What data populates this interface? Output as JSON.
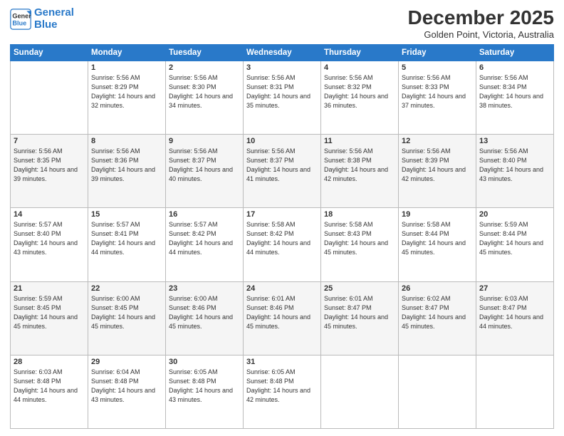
{
  "logo": {
    "line1": "General",
    "line2": "Blue"
  },
  "title": "December 2025",
  "subtitle": "Golden Point, Victoria, Australia",
  "days_header": [
    "Sunday",
    "Monday",
    "Tuesday",
    "Wednesday",
    "Thursday",
    "Friday",
    "Saturday"
  ],
  "weeks": [
    [
      {
        "day": "",
        "sunrise": "",
        "sunset": "",
        "daylight": ""
      },
      {
        "day": "1",
        "sunrise": "5:56 AM",
        "sunset": "8:29 PM",
        "daylight": "14 hours and 32 minutes."
      },
      {
        "day": "2",
        "sunrise": "5:56 AM",
        "sunset": "8:30 PM",
        "daylight": "14 hours and 34 minutes."
      },
      {
        "day": "3",
        "sunrise": "5:56 AM",
        "sunset": "8:31 PM",
        "daylight": "14 hours and 35 minutes."
      },
      {
        "day": "4",
        "sunrise": "5:56 AM",
        "sunset": "8:32 PM",
        "daylight": "14 hours and 36 minutes."
      },
      {
        "day": "5",
        "sunrise": "5:56 AM",
        "sunset": "8:33 PM",
        "daylight": "14 hours and 37 minutes."
      },
      {
        "day": "6",
        "sunrise": "5:56 AM",
        "sunset": "8:34 PM",
        "daylight": "14 hours and 38 minutes."
      }
    ],
    [
      {
        "day": "7",
        "sunrise": "5:56 AM",
        "sunset": "8:35 PM",
        "daylight": "14 hours and 39 minutes."
      },
      {
        "day": "8",
        "sunrise": "5:56 AM",
        "sunset": "8:36 PM",
        "daylight": "14 hours and 39 minutes."
      },
      {
        "day": "9",
        "sunrise": "5:56 AM",
        "sunset": "8:37 PM",
        "daylight": "14 hours and 40 minutes."
      },
      {
        "day": "10",
        "sunrise": "5:56 AM",
        "sunset": "8:37 PM",
        "daylight": "14 hours and 41 minutes."
      },
      {
        "day": "11",
        "sunrise": "5:56 AM",
        "sunset": "8:38 PM",
        "daylight": "14 hours and 42 minutes."
      },
      {
        "day": "12",
        "sunrise": "5:56 AM",
        "sunset": "8:39 PM",
        "daylight": "14 hours and 42 minutes."
      },
      {
        "day": "13",
        "sunrise": "5:56 AM",
        "sunset": "8:40 PM",
        "daylight": "14 hours and 43 minutes."
      }
    ],
    [
      {
        "day": "14",
        "sunrise": "5:57 AM",
        "sunset": "8:40 PM",
        "daylight": "14 hours and 43 minutes."
      },
      {
        "day": "15",
        "sunrise": "5:57 AM",
        "sunset": "8:41 PM",
        "daylight": "14 hours and 44 minutes."
      },
      {
        "day": "16",
        "sunrise": "5:57 AM",
        "sunset": "8:42 PM",
        "daylight": "14 hours and 44 minutes."
      },
      {
        "day": "17",
        "sunrise": "5:58 AM",
        "sunset": "8:42 PM",
        "daylight": "14 hours and 44 minutes."
      },
      {
        "day": "18",
        "sunrise": "5:58 AM",
        "sunset": "8:43 PM",
        "daylight": "14 hours and 45 minutes."
      },
      {
        "day": "19",
        "sunrise": "5:58 AM",
        "sunset": "8:44 PM",
        "daylight": "14 hours and 45 minutes."
      },
      {
        "day": "20",
        "sunrise": "5:59 AM",
        "sunset": "8:44 PM",
        "daylight": "14 hours and 45 minutes."
      }
    ],
    [
      {
        "day": "21",
        "sunrise": "5:59 AM",
        "sunset": "8:45 PM",
        "daylight": "14 hours and 45 minutes."
      },
      {
        "day": "22",
        "sunrise": "6:00 AM",
        "sunset": "8:45 PM",
        "daylight": "14 hours and 45 minutes."
      },
      {
        "day": "23",
        "sunrise": "6:00 AM",
        "sunset": "8:46 PM",
        "daylight": "14 hours and 45 minutes."
      },
      {
        "day": "24",
        "sunrise": "6:01 AM",
        "sunset": "8:46 PM",
        "daylight": "14 hours and 45 minutes."
      },
      {
        "day": "25",
        "sunrise": "6:01 AM",
        "sunset": "8:47 PM",
        "daylight": "14 hours and 45 minutes."
      },
      {
        "day": "26",
        "sunrise": "6:02 AM",
        "sunset": "8:47 PM",
        "daylight": "14 hours and 45 minutes."
      },
      {
        "day": "27",
        "sunrise": "6:03 AM",
        "sunset": "8:47 PM",
        "daylight": "14 hours and 44 minutes."
      }
    ],
    [
      {
        "day": "28",
        "sunrise": "6:03 AM",
        "sunset": "8:48 PM",
        "daylight": "14 hours and 44 minutes."
      },
      {
        "day": "29",
        "sunrise": "6:04 AM",
        "sunset": "8:48 PM",
        "daylight": "14 hours and 43 minutes."
      },
      {
        "day": "30",
        "sunrise": "6:05 AM",
        "sunset": "8:48 PM",
        "daylight": "14 hours and 43 minutes."
      },
      {
        "day": "31",
        "sunrise": "6:05 AM",
        "sunset": "8:48 PM",
        "daylight": "14 hours and 42 minutes."
      },
      {
        "day": "",
        "sunrise": "",
        "sunset": "",
        "daylight": ""
      },
      {
        "day": "",
        "sunrise": "",
        "sunset": "",
        "daylight": ""
      },
      {
        "day": "",
        "sunrise": "",
        "sunset": "",
        "daylight": ""
      }
    ]
  ]
}
